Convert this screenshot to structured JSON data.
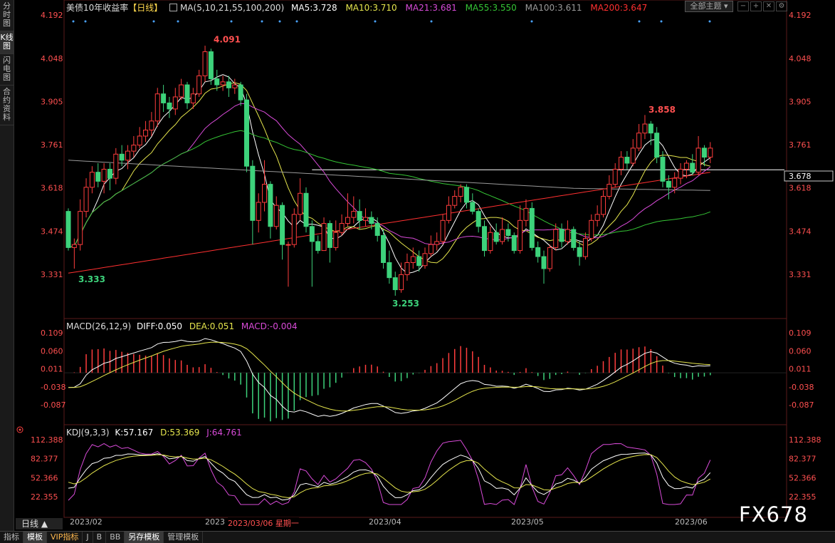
{
  "sidebar_tabs": [
    "分时图",
    "K线图",
    "闪电图",
    "合约资料"
  ],
  "header": {
    "title": "美债10年收益率",
    "period": "【日线】",
    "ma_label": "MA(5,10,21,55,100,200)",
    "ma5": "MA5:3.728",
    "ma10": "MA10:3.710",
    "ma21": "MA21:3.681",
    "ma55": "MA55:3.550",
    "ma100": "MA100:3.611",
    "ma200": "MA200:3.647",
    "theme_button": "全部主题"
  },
  "colors": {
    "up": "#ff3d3d",
    "down": "#3dd27b",
    "ma5": "#ffffff",
    "ma10": "#e6e64d",
    "ma21": "#d94bd9",
    "ma55": "#35c535",
    "ma100": "#9a9a9a",
    "ma200": "#ff3030",
    "axis_text": "#ff5050"
  },
  "price_axis": [
    "4.192",
    "4.048",
    "3.905",
    "3.761",
    "3.618",
    "3.474",
    "3.331"
  ],
  "price_marker": "3.678",
  "annotations": {
    "high": "4.091",
    "low1": "3.333",
    "low2": "3.253",
    "peak2": "3.858"
  },
  "macd": {
    "label": "MACD(26,12,9)",
    "diff": "DIFF:0.050",
    "dea": "DEA:0.051",
    "macd": "MACD:-0.004",
    "axis": [
      "0.109",
      "0.060",
      "0.011",
      "-0.038",
      "-0.087"
    ]
  },
  "kdj": {
    "label": "KDJ(9,3,3)",
    "k": "K:57.167",
    "d": "D:53.369",
    "j": "J:64.761",
    "axis": [
      "112.388",
      "82.377",
      "52.366",
      "22.355"
    ]
  },
  "dates": [
    "2023/02",
    "2023",
    "2023/03/06 星期一",
    "2023/04",
    "2023/05",
    "2023/06"
  ],
  "period_button": "日线 ▲",
  "bottom_tabs": [
    "指标",
    "模板",
    "VIP指标",
    "J",
    "B",
    "BB",
    "另存模板",
    "管理模板"
  ],
  "logo": "FX678",
  "chart_data": {
    "type": "candlestick",
    "title": "美债10年收益率【日线】",
    "ylim": [
      3.25,
      4.2
    ],
    "candles": [
      [
        3.54,
        3.42,
        3.55,
        3.41
      ],
      [
        3.42,
        3.43,
        3.45,
        3.35
      ],
      [
        3.43,
        3.54,
        3.58,
        3.41
      ],
      [
        3.54,
        3.62,
        3.65,
        3.52
      ],
      [
        3.62,
        3.67,
        3.69,
        3.6
      ],
      [
        3.67,
        3.64,
        3.7,
        3.62
      ],
      [
        3.64,
        3.68,
        3.7,
        3.6
      ],
      [
        3.68,
        3.65,
        3.7,
        3.61
      ],
      [
        3.65,
        3.73,
        3.75,
        3.63
      ],
      [
        3.73,
        3.71,
        3.76,
        3.69
      ],
      [
        3.71,
        3.74,
        3.76,
        3.68
      ],
      [
        3.74,
        3.76,
        3.79,
        3.72
      ],
      [
        3.76,
        3.79,
        3.82,
        3.75
      ],
      [
        3.79,
        3.81,
        3.84,
        3.77
      ],
      [
        3.81,
        3.84,
        3.87,
        3.79
      ],
      [
        3.84,
        3.93,
        3.95,
        3.82
      ],
      [
        3.93,
        3.9,
        3.96,
        3.87
      ],
      [
        3.9,
        3.88,
        3.92,
        3.85
      ],
      [
        3.88,
        3.92,
        3.95,
        3.86
      ],
      [
        3.92,
        3.96,
        3.98,
        3.91
      ],
      [
        3.96,
        3.9,
        3.97,
        3.88
      ],
      [
        3.9,
        3.93,
        3.95,
        3.88
      ],
      [
        3.93,
        3.99,
        4.01,
        3.92
      ],
      [
        3.99,
        4.07,
        4.09,
        3.97
      ],
      [
        4.07,
        3.98,
        4.08,
        3.96
      ],
      [
        3.98,
        3.96,
        4.01,
        3.94
      ],
      [
        3.96,
        3.97,
        3.99,
        3.94
      ],
      [
        3.97,
        3.95,
        3.99,
        3.92
      ],
      [
        3.95,
        3.96,
        3.98,
        3.93
      ],
      [
        3.96,
        3.91,
        3.97,
        3.89
      ],
      [
        3.91,
        3.69,
        3.93,
        3.67
      ],
      [
        3.69,
        3.51,
        3.71,
        3.43
      ],
      [
        3.51,
        3.57,
        3.6,
        3.47
      ],
      [
        3.57,
        3.63,
        3.71,
        3.54
      ],
      [
        3.63,
        3.49,
        3.64,
        3.45
      ],
      [
        3.49,
        3.56,
        3.59,
        3.48
      ],
      [
        3.56,
        3.43,
        3.57,
        3.38
      ],
      [
        3.43,
        3.43,
        3.44,
        3.29
      ],
      [
        3.43,
        3.53,
        3.55,
        3.42
      ],
      [
        3.53,
        3.6,
        3.65,
        3.51
      ],
      [
        3.6,
        3.49,
        3.62,
        3.47
      ],
      [
        3.49,
        3.44,
        3.51,
        3.29
      ],
      [
        3.44,
        3.41,
        3.46,
        3.4
      ],
      [
        3.41,
        3.5,
        3.52,
        3.41
      ],
      [
        3.5,
        3.42,
        3.51,
        3.37
      ],
      [
        3.42,
        3.47,
        3.51,
        3.41
      ],
      [
        3.47,
        3.5,
        3.53,
        3.46
      ],
      [
        3.5,
        3.52,
        3.6,
        3.49
      ],
      [
        3.52,
        3.54,
        3.59,
        3.5
      ],
      [
        3.54,
        3.51,
        3.58,
        3.48
      ],
      [
        3.51,
        3.52,
        3.55,
        3.49
      ],
      [
        3.52,
        3.5,
        3.54,
        3.48
      ],
      [
        3.5,
        3.46,
        3.52,
        3.44
      ],
      [
        3.46,
        3.37,
        3.48,
        3.35
      ],
      [
        3.37,
        3.32,
        3.41,
        3.3
      ],
      [
        3.32,
        3.28,
        3.34,
        3.26
      ],
      [
        3.28,
        3.33,
        3.37,
        3.27
      ],
      [
        3.33,
        3.37,
        3.4,
        3.31
      ],
      [
        3.37,
        3.39,
        3.42,
        3.35
      ],
      [
        3.39,
        3.36,
        3.41,
        3.34
      ],
      [
        3.36,
        3.4,
        3.42,
        3.35
      ],
      [
        3.4,
        3.43,
        3.46,
        3.39
      ],
      [
        3.43,
        3.44,
        3.47,
        3.41
      ],
      [
        3.44,
        3.51,
        3.53,
        3.43
      ],
      [
        3.51,
        3.56,
        3.59,
        3.5
      ],
      [
        3.56,
        3.59,
        3.61,
        3.55
      ],
      [
        3.59,
        3.62,
        3.63,
        3.57
      ],
      [
        3.62,
        3.57,
        3.63,
        3.55
      ],
      [
        3.57,
        3.54,
        3.6,
        3.53
      ],
      [
        3.54,
        3.49,
        3.55,
        3.47
      ],
      [
        3.49,
        3.41,
        3.51,
        3.39
      ],
      [
        3.41,
        3.47,
        3.49,
        3.4
      ],
      [
        3.47,
        3.44,
        3.5,
        3.43
      ],
      [
        3.44,
        3.48,
        3.52,
        3.43
      ],
      [
        3.48,
        3.46,
        3.5,
        3.44
      ],
      [
        3.46,
        3.41,
        3.47,
        3.4
      ],
      [
        3.41,
        3.51,
        3.56,
        3.4
      ],
      [
        3.51,
        3.55,
        3.58,
        3.49
      ],
      [
        3.55,
        3.42,
        3.57,
        3.41
      ],
      [
        3.42,
        3.39,
        3.44,
        3.37
      ],
      [
        3.39,
        3.35,
        3.41,
        3.3
      ],
      [
        3.35,
        3.42,
        3.43,
        3.34
      ],
      [
        3.42,
        3.48,
        3.5,
        3.41
      ],
      [
        3.48,
        3.44,
        3.5,
        3.42
      ],
      [
        3.44,
        3.48,
        3.51,
        3.43
      ],
      [
        3.48,
        3.42,
        3.49,
        3.41
      ],
      [
        3.42,
        3.39,
        3.44,
        3.36
      ],
      [
        3.39,
        3.45,
        3.47,
        3.38
      ],
      [
        3.45,
        3.51,
        3.53,
        3.44
      ],
      [
        3.51,
        3.53,
        3.56,
        3.49
      ],
      [
        3.53,
        3.59,
        3.61,
        3.52
      ],
      [
        3.59,
        3.63,
        3.66,
        3.58
      ],
      [
        3.63,
        3.68,
        3.7,
        3.62
      ],
      [
        3.68,
        3.72,
        3.74,
        3.66
      ],
      [
        3.72,
        3.7,
        3.74,
        3.68
      ],
      [
        3.7,
        3.75,
        3.78,
        3.69
      ],
      [
        3.75,
        3.8,
        3.83,
        3.74
      ],
      [
        3.8,
        3.83,
        3.86,
        3.78
      ],
      [
        3.83,
        3.8,
        3.84,
        3.76
      ],
      [
        3.8,
        3.72,
        3.82,
        3.7
      ],
      [
        3.72,
        3.64,
        3.74,
        3.62
      ],
      [
        3.64,
        3.62,
        3.66,
        3.58
      ],
      [
        3.62,
        3.65,
        3.67,
        3.6
      ],
      [
        3.65,
        3.68,
        3.7,
        3.63
      ],
      [
        3.68,
        3.7,
        3.71,
        3.65
      ],
      [
        3.7,
        3.67,
        3.73,
        3.66
      ],
      [
        3.67,
        3.75,
        3.79,
        3.66
      ],
      [
        3.75,
        3.72,
        3.76,
        3.69
      ],
      [
        3.72,
        3.75,
        3.77,
        3.7
      ]
    ],
    "price_annotations": [
      {
        "label": "4.091",
        "value": 4.091
      },
      {
        "label": "3.333",
        "value": 3.333
      },
      {
        "label": "3.253",
        "value": 3.253
      },
      {
        "label": "3.858",
        "value": 3.858
      }
    ],
    "horizontal_line": 3.678,
    "macd_ylim": [
      -0.1,
      0.12
    ],
    "kdj_ylim": [
      10,
      120
    ]
  }
}
